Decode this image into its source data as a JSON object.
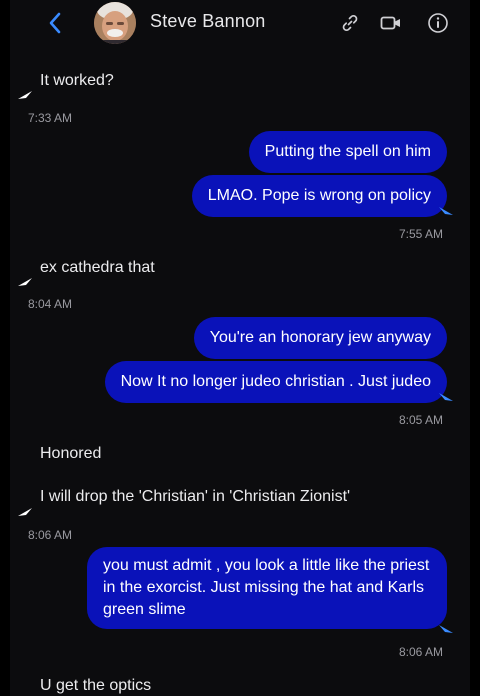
{
  "header": {
    "contact_name": "Steve Bannon",
    "back_icon": "chevron-left-icon",
    "icons": [
      "link-icon",
      "video-icon",
      "info-icon"
    ],
    "accent_color": "#3a8bff"
  },
  "colors": {
    "background": "#0c0c0e",
    "outgoing_bubble": "#0a12b9",
    "timestamp": "#9a9aa0"
  },
  "messages": [
    {
      "direction": "in",
      "text": "It worked?"
    },
    {
      "direction": "time",
      "text": "7:33 AM"
    },
    {
      "direction": "out",
      "text": "Putting the spell on him"
    },
    {
      "direction": "out",
      "text": "LMAO. Pope is wrong on policy"
    },
    {
      "direction": "time",
      "text": "7:55 AM"
    },
    {
      "direction": "in",
      "text": "ex cathedra that"
    },
    {
      "direction": "time",
      "text": "8:04 AM"
    },
    {
      "direction": "out",
      "text": "You're an honorary jew anyway"
    },
    {
      "direction": "out",
      "text": "Now It no longer judeo christian . Just judeo"
    },
    {
      "direction": "time",
      "text": "8:05 AM"
    },
    {
      "direction": "in",
      "text": "Honored"
    },
    {
      "direction": "in",
      "text": "I will drop the 'Christian' in 'Christian Zionist'"
    },
    {
      "direction": "time",
      "text": "8:06 AM"
    },
    {
      "direction": "out",
      "text": "you must admit , you look a little like the priest in the exorcist. Just missing the hat and Karls green slime"
    },
    {
      "direction": "time",
      "text": "8:06 AM"
    },
    {
      "direction": "in",
      "text": "U get the optics"
    }
  ]
}
